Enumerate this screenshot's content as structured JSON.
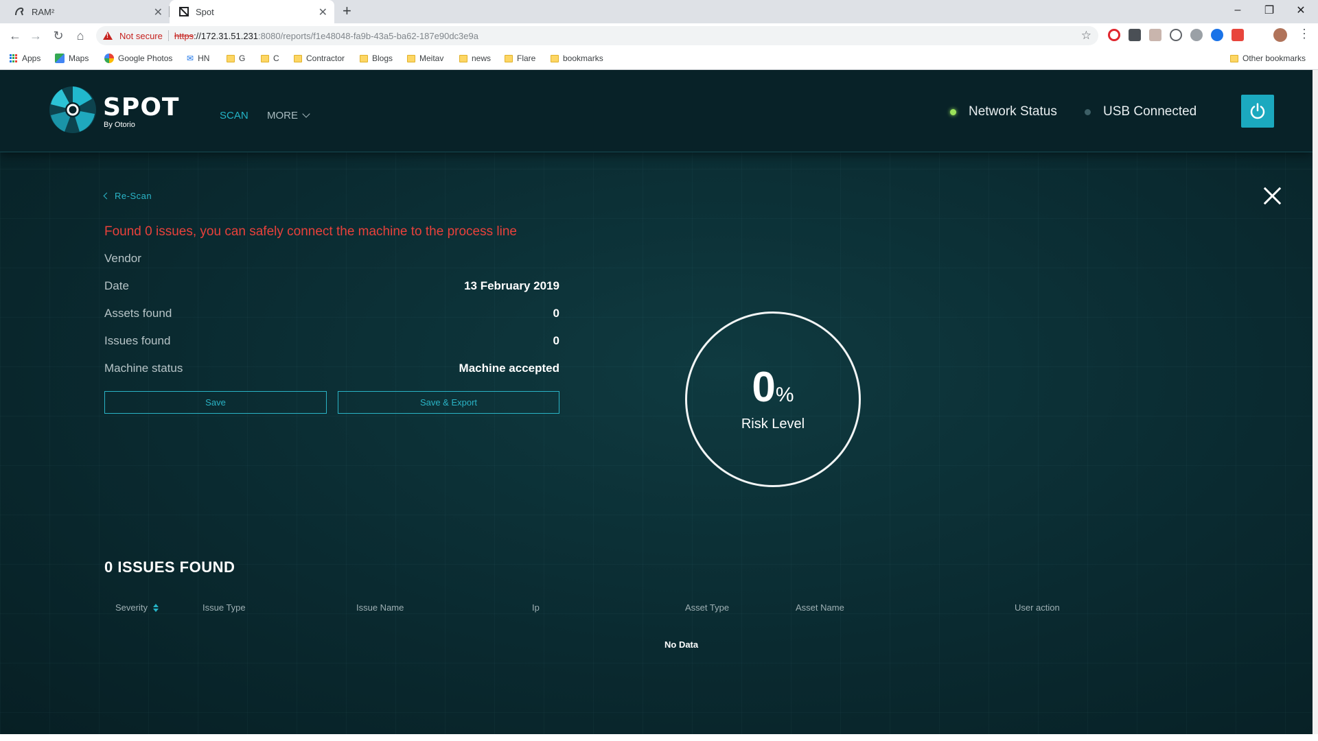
{
  "browser": {
    "tabs": [
      {
        "title": "RAM²",
        "active": false
      },
      {
        "title": "Spot",
        "active": true
      }
    ],
    "security_label": "Not secure",
    "url": {
      "scheme": "https",
      "host": "://172.31.51.231",
      "path": ":8080/reports/f1e48048-fa9b-43a5-ba62-187e90dc3e9a"
    },
    "bookmarks": [
      {
        "label": "Apps",
        "icon": "apps-grid-icon"
      },
      {
        "label": "Maps",
        "icon": "maps-icon"
      },
      {
        "label": "Google Photos",
        "icon": "photos-icon"
      },
      {
        "label": "HN",
        "icon": "mail-icon"
      },
      {
        "label": "G",
        "icon": "folder-icon"
      },
      {
        "label": "C",
        "icon": "folder-icon"
      },
      {
        "label": "Contractor",
        "icon": "folder-icon"
      },
      {
        "label": "Blogs",
        "icon": "folder-icon"
      },
      {
        "label": "Meitav",
        "icon": "folder-icon"
      },
      {
        "label": "news",
        "icon": "folder-icon"
      },
      {
        "label": "Flare",
        "icon": "folder-icon"
      },
      {
        "label": "bookmarks",
        "icon": "folder-icon"
      }
    ],
    "other_bookmarks": "Other bookmarks",
    "colors": {
      "chrome_bg": "#dee1e6",
      "insecure_red": "#c5221f"
    }
  },
  "app": {
    "brand": "SPOT",
    "brand_sub": "By Otorio",
    "nav": [
      {
        "label": "SCAN",
        "active": true
      },
      {
        "label": "MORE",
        "active": false
      }
    ],
    "status": [
      {
        "label": "Network Status",
        "dot_color": "#9be25a"
      },
      {
        "label": "USB Connected",
        "dot_color": "#3d5f66"
      }
    ],
    "colors": {
      "accent": "#1ba9bf",
      "alert": "#e8413b",
      "background": "#0a2a30"
    }
  },
  "report": {
    "back_label": "Re-Scan",
    "message": "Found 0 issues, you can safely connect the machine to the process line",
    "rows": [
      {
        "label": "Vendor",
        "value": ""
      },
      {
        "label": "Date",
        "value": "13 February 2019"
      },
      {
        "label": "Assets found",
        "value": "0"
      },
      {
        "label": "Issues found",
        "value": "0"
      },
      {
        "label": "Machine status",
        "value": "Machine accepted"
      }
    ],
    "buttons": {
      "save": "Save",
      "save_export": "Save & Export"
    },
    "risk": {
      "value": "0",
      "unit": "%",
      "label": "Risk Level"
    }
  },
  "issues": {
    "title": "0 ISSUES FOUND",
    "columns": [
      "Severity",
      "Issue Type",
      "Issue Name",
      "Ip",
      "Asset Type",
      "Asset Name",
      "User action"
    ],
    "empty_text": "No Data"
  }
}
